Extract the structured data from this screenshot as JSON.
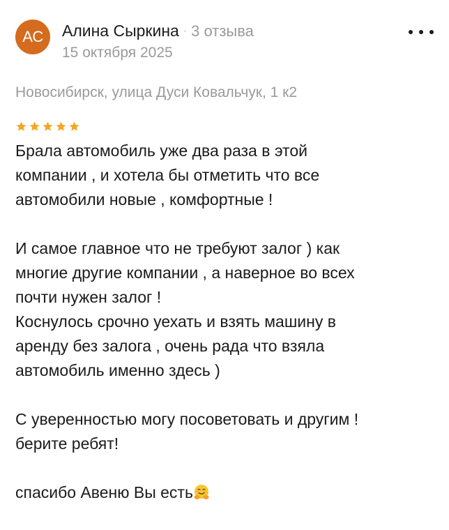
{
  "review": {
    "avatar_initials": "AC",
    "author_name": "Алина Сыркина",
    "separator": "·",
    "review_count": "3 отзыва",
    "date": "15 октября 2025",
    "address": "Новосибирск, улица Дуси Ковальчук, 1 к2",
    "rating": 5,
    "rating_max": 5,
    "text_lines": [
      "Брала автомобиль уже два раза в этой",
      "компании , и хотела бы отметить что все",
      "автомобили новые , комфортные !",
      "",
      "И самое главное что не требуют залог ) как",
      "многие другие компании , а наверное во всех",
      "почти нужен залог !",
      "Коснулось срочно уехать и взять машину в",
      "аренду без залога , очень рада что взяла",
      "автомобиль именно здесь )",
      "",
      "С уверенностью могу посоветовать и другим !",
      "берите ребят!",
      "",
      "спасибо Авеню Вы есть"
    ],
    "final_emoji_icon": "hugging-face-icon"
  },
  "colors": {
    "avatar_bg": "#d46b1d",
    "star": "#f5a623",
    "muted_text": "#9a9a9a",
    "main_text": "#1b1b1b"
  }
}
